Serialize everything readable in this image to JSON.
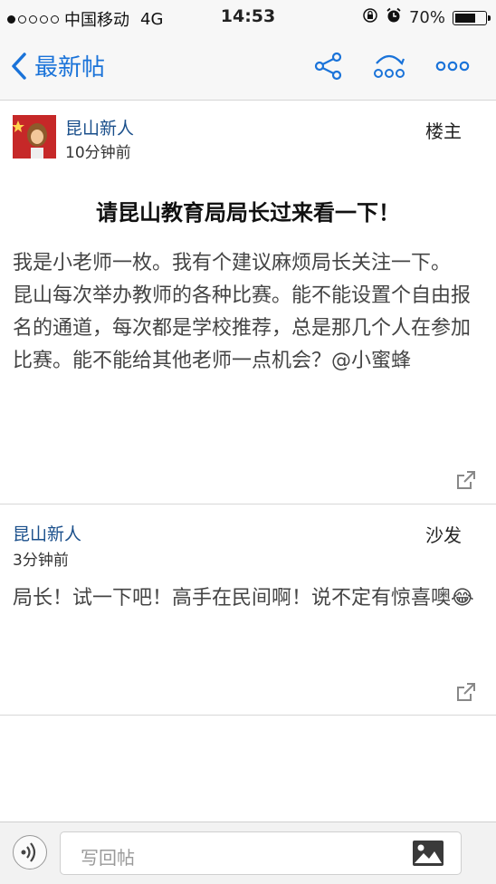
{
  "status_bar": {
    "carrier": "中国移动",
    "network": "4G",
    "time": "14:53",
    "battery": "70%",
    "battery_level": 0.7
  },
  "nav": {
    "back_label": "最新帖"
  },
  "main_post": {
    "author": "昆山新人",
    "time": "10分钟前",
    "floor": "楼主",
    "title": "请昆山教育局局长过来看一下！",
    "body": "我是小老师一枚。我有个建议麻烦局长关注一下。\n昆山每次举办教师的各种比赛。能不能设置个自由报名的通道，每次都是学校推荐，总是那几个人在参加比赛。能不能给其他老师一点机会？@小蜜蜂"
  },
  "reply_post": {
    "author": "昆山新人",
    "time": "3分钟前",
    "floor": "沙发",
    "body": "局长！试一下吧！高手在民间啊！说不定有惊喜噢😂"
  },
  "bottom_bar": {
    "reply_placeholder": "写回帖"
  },
  "colors": {
    "accent": "#1a73d9",
    "author": "#1a4f8b"
  }
}
